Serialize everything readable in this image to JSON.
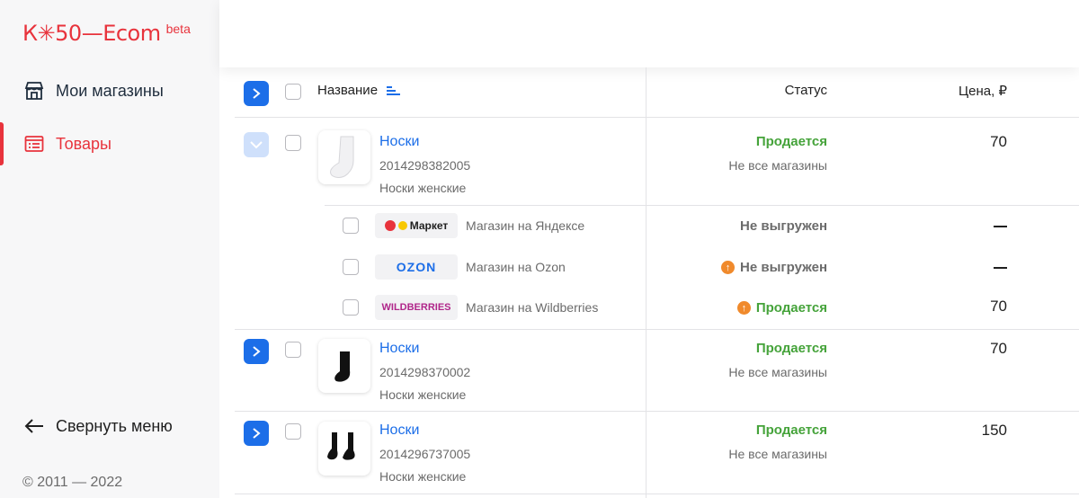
{
  "app": {
    "logo": "К✳50—Ecom",
    "beta": "beta",
    "accent": "#e8333c",
    "link_color": "#1c6ee8",
    "sale_color": "#45a33a"
  },
  "sidebar": {
    "items": [
      {
        "label": "Мои магазины",
        "icon": "store-icon",
        "active": false
      },
      {
        "label": "Товары",
        "icon": "list-icon",
        "active": true
      }
    ],
    "collapse_label": "Свернуть меню",
    "copyright": "© 2011 — 2022"
  },
  "table": {
    "headers": {
      "name": "Название",
      "status": "Статус",
      "price": "Цена, ₽"
    },
    "products": [
      {
        "name": "Носки",
        "code": "2014298382005",
        "category": "Носки женские",
        "status": "Продается",
        "status_sub": "Не все магазины",
        "price": "70",
        "expanded": true,
        "image": "white-sock",
        "marketplaces": [
          {
            "badge": "Маркет",
            "store": "Магазин на Яндексе",
            "status": "Не выгружен",
            "warning": false,
            "price": "—"
          },
          {
            "badge": "OZON",
            "store": "Магазин на Ozon",
            "status": "Не выгружен",
            "warning": true,
            "price": "—"
          },
          {
            "badge": "WILDBERRIES",
            "store": "Магазин на Wildberries",
            "status": "Продается",
            "warning": true,
            "price": "70"
          }
        ]
      },
      {
        "name": "Носки",
        "code": "2014298370002",
        "category": "Носки женские",
        "status": "Продается",
        "status_sub": "Не все магазины",
        "price": "70",
        "expanded": false,
        "image": "black-sock"
      },
      {
        "name": "Носки",
        "code": "2014296737005",
        "category": "Носки женские",
        "status": "Продается",
        "status_sub": "Не все магазины",
        "price": "150",
        "expanded": false,
        "image": "black-ankle-socks"
      }
    ]
  }
}
